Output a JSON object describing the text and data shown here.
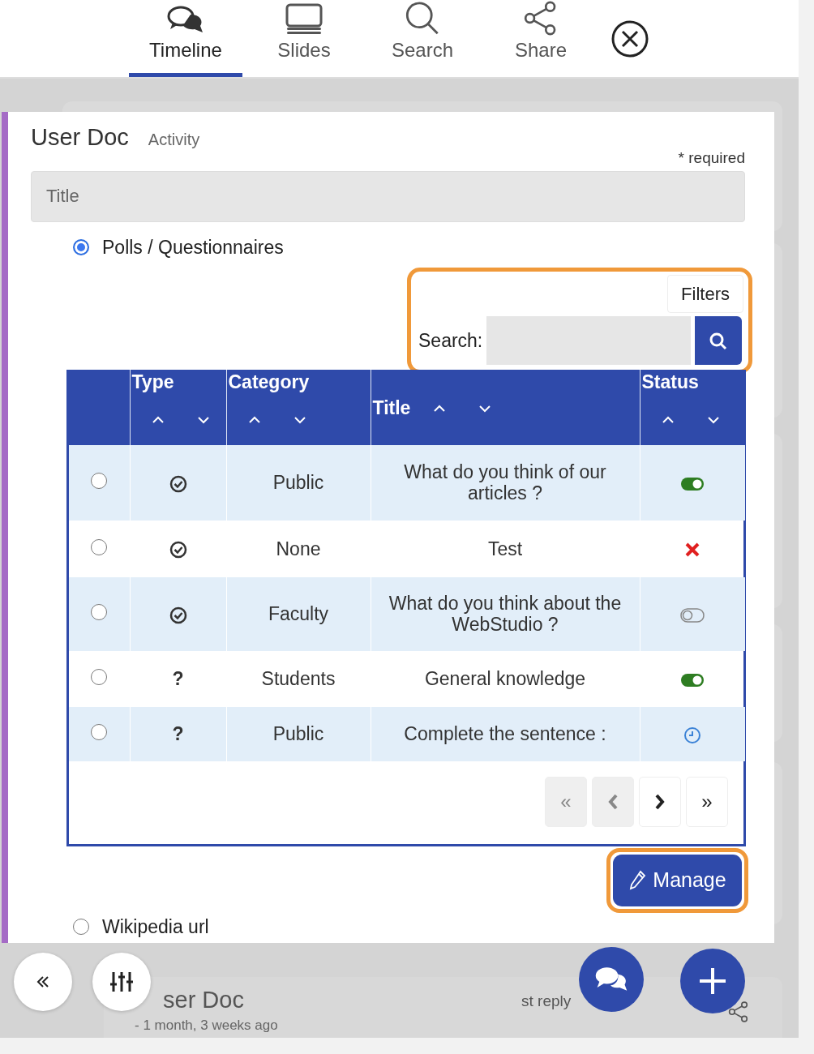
{
  "nav": {
    "tabs": [
      {
        "label": "Timeline",
        "selected": true
      },
      {
        "label": "Slides",
        "selected": false
      },
      {
        "label": "Search",
        "selected": false
      },
      {
        "label": "Share",
        "selected": false
      }
    ]
  },
  "form": {
    "title": "User Doc",
    "subtitle": "Activity",
    "required_note": "* required",
    "title_field": {
      "placeholder": "Title"
    },
    "sources": [
      {
        "label": "Polls / Questionnaires",
        "selected": true
      },
      {
        "label": "Wikipedia url",
        "selected": false
      }
    ],
    "filters_button": "Filters",
    "search_label": "Search:",
    "table": {
      "columns": [
        {
          "label": "Type"
        },
        {
          "label": "Category"
        },
        {
          "label": "Title"
        },
        {
          "label": "Status"
        }
      ],
      "rows": [
        {
          "selected": false,
          "type": {
            "kind": "check"
          },
          "category": "Public",
          "title": "What do you think of our articles ?",
          "status": {
            "kind": "on"
          }
        },
        {
          "selected": false,
          "type": {
            "kind": "check"
          },
          "category": "None",
          "title": "Test",
          "status": {
            "kind": "error"
          }
        },
        {
          "selected": false,
          "type": {
            "kind": "check"
          },
          "category": "Faculty",
          "title": "What do you think about the WebStudio ?",
          "status": {
            "kind": "off"
          }
        },
        {
          "selected": false,
          "type": {
            "kind": "text",
            "label": "?"
          },
          "category": "Students",
          "title": "General knowledge",
          "status": {
            "kind": "on"
          }
        },
        {
          "selected": false,
          "type": {
            "kind": "text",
            "label": "?"
          },
          "category": "Public",
          "title": "Complete the sentence :",
          "status": {
            "kind": "pending"
          }
        }
      ]
    },
    "pagination": [
      {
        "kind": "text",
        "label": "«",
        "disabled": true
      },
      {
        "kind": "prev",
        "disabled": true
      },
      {
        "kind": "next",
        "disabled": false
      },
      {
        "kind": "text",
        "label": "»",
        "disabled": false
      }
    ],
    "manage_button": "Manage"
  },
  "background_post": {
    "title": "ser Doc",
    "meta": "- 1 month, 3 weeks ago",
    "reply": "st reply"
  }
}
